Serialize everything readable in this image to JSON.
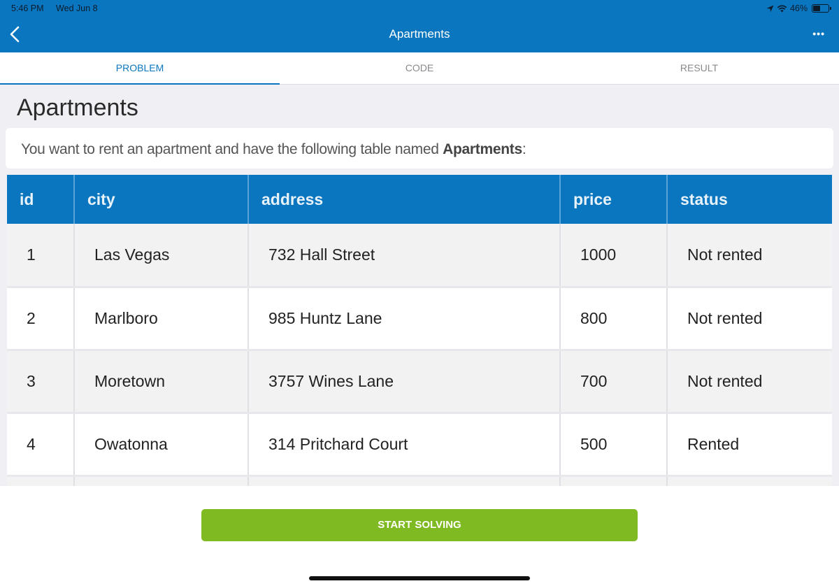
{
  "status_bar": {
    "time": "5:46 PM",
    "date": "Wed Jun 8",
    "battery": "46%",
    "battery_level_percent": 46
  },
  "nav": {
    "title": "Apartments",
    "back_icon": "chevron-left-icon",
    "more_icon": "ellipsis-icon",
    "more_label": "•••"
  },
  "tabs": [
    {
      "label": "PROBLEM",
      "active": true
    },
    {
      "label": "CODE",
      "active": false
    },
    {
      "label": "RESULT",
      "active": false
    }
  ],
  "problem": {
    "title": "Apartments",
    "description_prefix": "You want to rent an apartment and have the following table named ",
    "description_bold": "Apartments",
    "description_suffix": ":"
  },
  "table": {
    "columns": [
      "id",
      "city",
      "address",
      "price",
      "status"
    ],
    "rows": [
      [
        "1",
        "Las Vegas",
        "732 Hall Street",
        "1000",
        "Not rented"
      ],
      [
        "2",
        "Marlboro",
        "985 Huntz Lane",
        "800",
        "Not rented"
      ],
      [
        "3",
        "Moretown",
        "3757 Wines Lane",
        "700",
        "Not rented"
      ],
      [
        "4",
        "Owatonna",
        "314 Pritchard Court",
        "500",
        "Rented"
      ],
      [
        "",
        "",
        "",
        "",
        ""
      ]
    ]
  },
  "actions": {
    "start_label": "START SOLVING"
  },
  "colors": {
    "brand_blue": "#0a76bf",
    "start_green": "#80ba22"
  }
}
